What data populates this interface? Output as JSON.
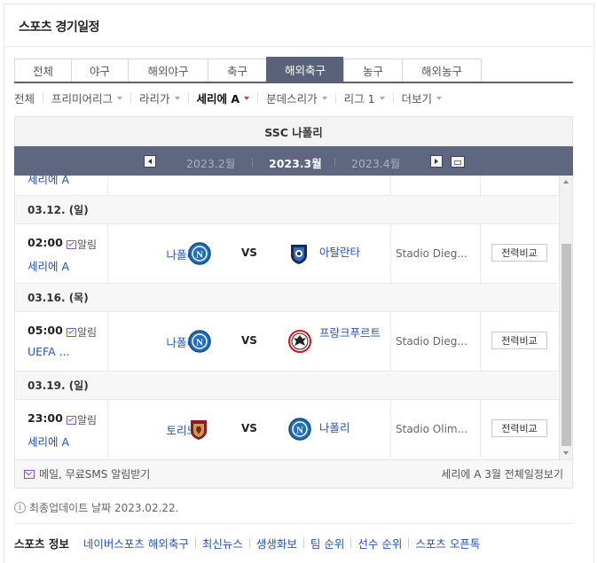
{
  "header": {
    "title": "스포츠 경기일정"
  },
  "tabs": [
    {
      "label": "전체",
      "active": false
    },
    {
      "label": "야구",
      "active": false
    },
    {
      "label": "해외야구",
      "active": false
    },
    {
      "label": "축구",
      "active": false
    },
    {
      "label": "해외축구",
      "active": true
    },
    {
      "label": "농구",
      "active": false
    },
    {
      "label": "해외농구",
      "active": false
    }
  ],
  "subnav": [
    {
      "label": "전체",
      "dropdown": false,
      "active": false
    },
    {
      "label": "프리미어리그",
      "dropdown": true,
      "active": false
    },
    {
      "label": "라리가",
      "dropdown": true,
      "active": false
    },
    {
      "label": "세리에 A",
      "dropdown": true,
      "active": true
    },
    {
      "label": "분데스리가",
      "dropdown": true,
      "active": false
    },
    {
      "label": "리그 1",
      "dropdown": true,
      "active": false
    },
    {
      "label": "더보기",
      "dropdown": true,
      "active": false
    }
  ],
  "team": {
    "name": "SSC 나폴리"
  },
  "months": {
    "prev": "2023.2월",
    "current": "2023.3월",
    "next": "2023.4월"
  },
  "schedule": {
    "partial_top": {
      "league": "세리에 A"
    },
    "days": [
      {
        "date": "03.12. (일)",
        "game": {
          "time": "02:00",
          "alarm": "알림",
          "league": "세리에 A",
          "home": "나폴리",
          "vs": "VS",
          "away": "아탈란타",
          "stadium": "Stadio Dieg...",
          "compare": "전력비교"
        }
      },
      {
        "date": "03.16. (목)",
        "game": {
          "time": "05:00",
          "alarm": "알림",
          "league": "UEFA ...",
          "home": "나폴리",
          "vs": "VS",
          "away": "프랑크푸르트",
          "stadium": "Stadio Dieg...",
          "compare": "전력비교"
        }
      },
      {
        "date": "03.19. (일)",
        "game": {
          "time": "23:00",
          "alarm": "알림",
          "league": "세리에 A",
          "home": "토리노",
          "vs": "VS",
          "away": "나폴리",
          "stadium": "Stadio Olim...",
          "compare": "전력비교"
        }
      }
    ]
  },
  "footer": {
    "sms": "메일, 무료SMS 알림받기",
    "full_schedule": "세리에 A 3월 전체일정보기"
  },
  "updated": "최종업데이트 날짜 2023.02.22.",
  "links": {
    "label": "스포츠 정보",
    "items": [
      "네이버스포츠 해외축구",
      "최신뉴스",
      "생생화보",
      "팀 순위",
      "선수 순위",
      "스포츠 오픈톡"
    ]
  },
  "colors": {
    "accent": "#5a6279",
    "link": "#2452b8",
    "alarm": "#8a4ec9"
  }
}
